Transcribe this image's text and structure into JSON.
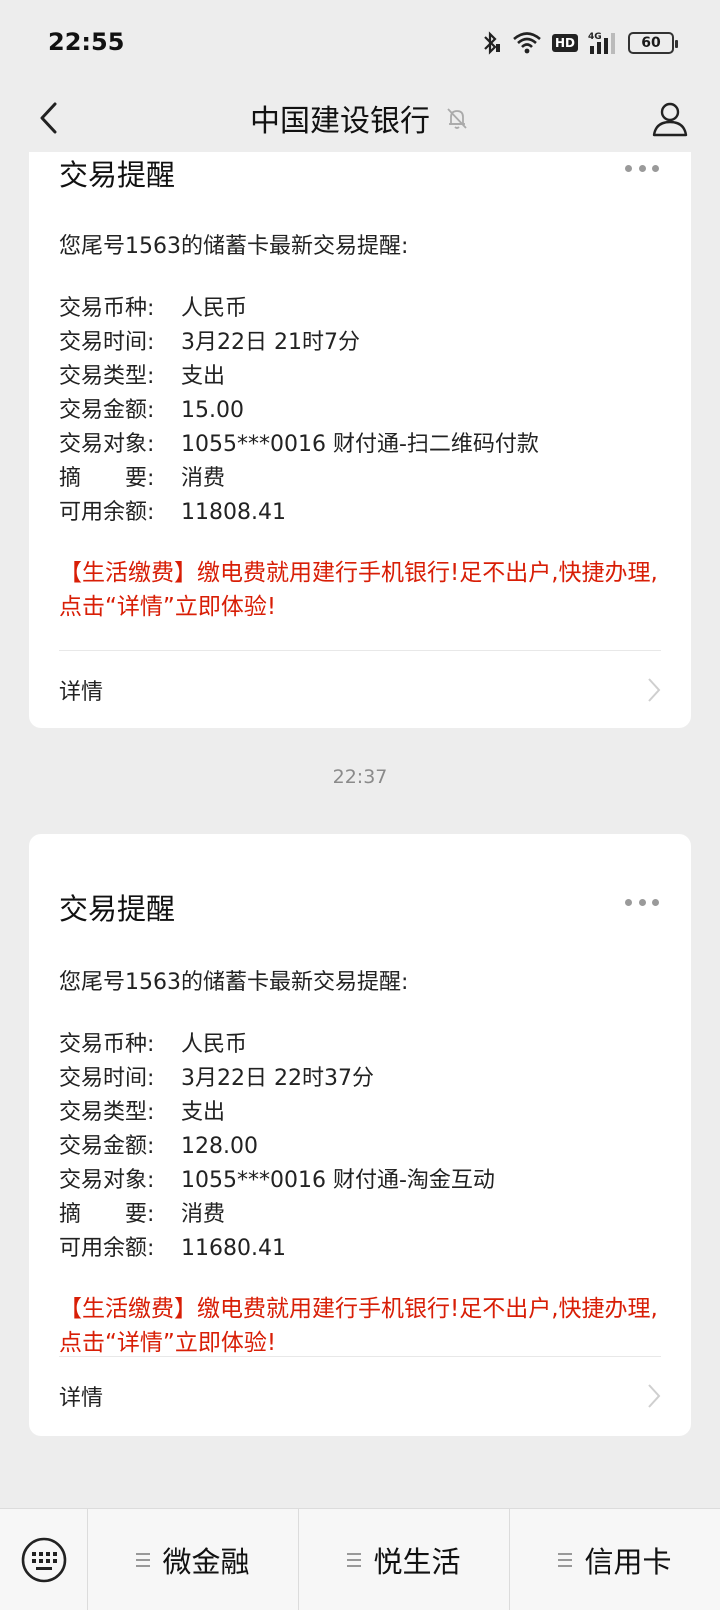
{
  "status_bar": {
    "time": "22:55",
    "battery": "60",
    "network": "4G",
    "hd_label": "HD",
    "icons": [
      "bluetooth-icon",
      "wifi-icon",
      "hd-icon",
      "signal-icon",
      "battery-icon"
    ]
  },
  "nav": {
    "title": "中国建设银行",
    "back_icon": "chevron-left-icon",
    "mute_icon": "bell-off-icon",
    "profile_icon": "user-icon"
  },
  "messages": [
    {
      "title": "交易提醒",
      "intro": "您尾号1563的储蓄卡最新交易提醒:",
      "fields": [
        {
          "label": "交易币种:",
          "value": "人民币"
        },
        {
          "label": "交易时间:",
          "value": "3月22日 21时7分"
        },
        {
          "label": "交易类型:",
          "value": "支出"
        },
        {
          "label": "交易金额:",
          "value": "15.00"
        },
        {
          "label": "交易对象:",
          "value": "1055***0016 财付通-扫二维码付款"
        },
        {
          "label": "摘　　要:",
          "value": "消费"
        },
        {
          "label": "可用余额:",
          "value": "11808.41"
        }
      ],
      "promo": "【生活缴费】缴电费就用建行手机银行!足不出户,快捷办理,点击“详情”立即体验!",
      "detail_label": "详情"
    },
    {
      "timestamp": "22:37",
      "title": "交易提醒",
      "intro": "您尾号1563的储蓄卡最新交易提醒:",
      "fields": [
        {
          "label": "交易币种:",
          "value": "人民币"
        },
        {
          "label": "交易时间:",
          "value": "3月22日 22时37分"
        },
        {
          "label": "交易类型:",
          "value": "支出"
        },
        {
          "label": "交易金额:",
          "value": "128.00"
        },
        {
          "label": "交易对象:",
          "value": "1055***0016 财付通-淘金互动"
        },
        {
          "label": "摘　　要:",
          "value": "消费"
        },
        {
          "label": "可用余额:",
          "value": "11680.41"
        }
      ],
      "promo": "【生活缴费】缴电费就用建行手机银行!足不出户,快捷办理,点击“详情”立即体验!",
      "detail_label": "详情"
    }
  ],
  "bottom_menu": {
    "keyboard_icon": "keyboard-icon",
    "tabs": [
      {
        "label": "微金融"
      },
      {
        "label": "悦生活"
      },
      {
        "label": "信用卡"
      }
    ]
  },
  "colors": {
    "background": "#ededed",
    "card": "#ffffff",
    "promo_red": "#d81e06"
  }
}
